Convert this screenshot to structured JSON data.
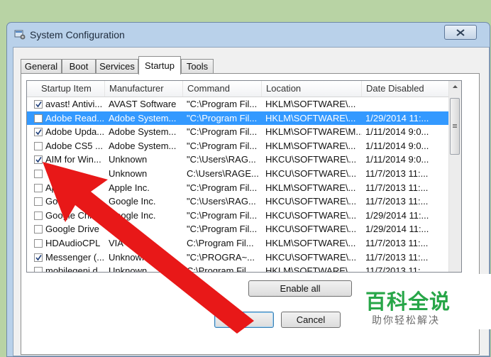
{
  "window": {
    "title": "System Configuration",
    "close_label": "✕"
  },
  "tabs": [
    {
      "label": "General",
      "active": false
    },
    {
      "label": "Boot",
      "active": false
    },
    {
      "label": "Services",
      "active": false
    },
    {
      "label": "Startup",
      "active": true
    },
    {
      "label": "Tools",
      "active": false
    }
  ],
  "columns": [
    "Startup Item",
    "Manufacturer",
    "Command",
    "Location",
    "Date Disabled"
  ],
  "rows": [
    {
      "checked": true,
      "selected": false,
      "item": "avast! Antivi...",
      "manufacturer": "AVAST Software",
      "command": "\"C:\\Program Fil...",
      "location": "HKLM\\SOFTWARE\\...",
      "date": ""
    },
    {
      "checked": false,
      "selected": true,
      "item": "Adobe Read...",
      "manufacturer": "Adobe System...",
      "command": "\"C:\\Program Fil...",
      "location": "HKLM\\SOFTWARE\\...",
      "date": "1/29/2014 11:..."
    },
    {
      "checked": true,
      "selected": false,
      "item": "Adobe Upda...",
      "manufacturer": "Adobe System...",
      "command": "\"C:\\Program Fil...",
      "location": "HKLM\\SOFTWARE\\M...",
      "date": "1/11/2014 9:0..."
    },
    {
      "checked": false,
      "selected": false,
      "item": "Adobe CS5 ...",
      "manufacturer": "Adobe System...",
      "command": "\"C:\\Program Fil...",
      "location": "HKLM\\SOFTWARE\\...",
      "date": "1/11/2014 9:0..."
    },
    {
      "checked": true,
      "selected": false,
      "item": "AIM for Win...",
      "manufacturer": "Unknown",
      "command": "\"C:\\Users\\RAG...",
      "location": "HKCU\\SOFTWARE\\...",
      "date": "1/11/2014 9:0..."
    },
    {
      "checked": false,
      "selected": false,
      "item": "",
      "manufacturer": "Unknown",
      "command": "C:\\Users\\RAGE...",
      "location": "HKCU\\SOFTWARE\\...",
      "date": "11/7/2013 11:..."
    },
    {
      "checked": false,
      "selected": false,
      "item": "Ap...sh",
      "manufacturer": "Apple Inc.",
      "command": "\"C:\\Program Fil...",
      "location": "HKLM\\SOFTWARE\\...",
      "date": "11/7/2013 11:..."
    },
    {
      "checked": false,
      "selected": false,
      "item": "Goo... Up...",
      "manufacturer": "Google Inc.",
      "command": "\"C:\\Users\\RAG...",
      "location": "HKCU\\SOFTWARE\\...",
      "date": "11/7/2013 11:..."
    },
    {
      "checked": false,
      "selected": false,
      "item": "Google Chrom",
      "manufacturer": "Google Inc.",
      "command": "\"C:\\Program Fil...",
      "location": "HKCU\\SOFTWARE\\...",
      "date": "1/29/2014 11:..."
    },
    {
      "checked": false,
      "selected": false,
      "item": "Google Drive",
      "manufacturer": "Go...",
      "command": "\"C:\\Program Fil...",
      "location": "HKCU\\SOFTWARE\\...",
      "date": "1/29/2014 11:..."
    },
    {
      "checked": false,
      "selected": false,
      "item": "HDAudioCPL",
      "manufacturer": "VIA",
      "command": "C:\\Program Fil...",
      "location": "HKLM\\SOFTWARE\\...",
      "date": "11/7/2013 11:..."
    },
    {
      "checked": true,
      "selected": false,
      "item": "Messenger (...",
      "manufacturer": "Unknown",
      "command": "\"C:\\PROGRA~...",
      "location": "HKCU\\SOFTWARE\\...",
      "date": "11/7/2013 11:..."
    },
    {
      "checked": false,
      "selected": false,
      "item": "mobilegeni.d...",
      "manufacturer": "Unknown",
      "command": "C:\\Program Fil...",
      "location": "HKLM\\SOFTWARE\\...",
      "date": "11/7/2013 11:..."
    }
  ],
  "buttons": {
    "enable_all": "Enable all",
    "ok": "",
    "cancel": "Cancel"
  },
  "watermark": {
    "title": "百科全说",
    "subtitle": "助你轻松解决"
  },
  "colors": {
    "selection": "#3399ff",
    "arrow": "#e81818",
    "watermark_green": "#27a648"
  }
}
